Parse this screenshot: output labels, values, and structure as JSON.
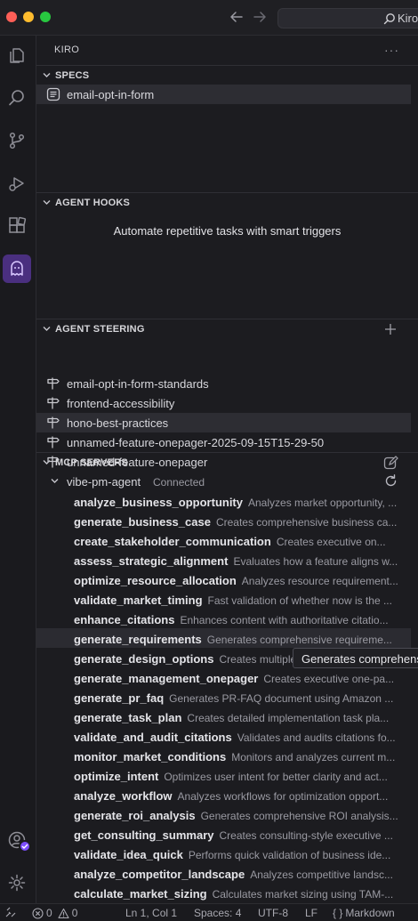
{
  "window": {
    "search_text": "Kiro"
  },
  "sidebar": {
    "title": "KIRO",
    "more": "···"
  },
  "specs": {
    "title": "SPECS",
    "items": [
      {
        "label": "email-opt-in-form"
      }
    ]
  },
  "hooks": {
    "title": "AGENT HOOKS",
    "empty_message": "Automate repetitive tasks with smart triggers"
  },
  "steering": {
    "title": "AGENT STEERING",
    "items": [
      {
        "label": "email-opt-in-form-standards"
      },
      {
        "label": "frontend-accessibility"
      },
      {
        "label": "hono-best-practices"
      },
      {
        "label": "unnamed-feature-onepager-2025-09-15T15-29-50"
      },
      {
        "label": "unnamed-feature-onepager"
      }
    ]
  },
  "mcp": {
    "title": "MCP SERVERS",
    "server": {
      "name": "vibe-pm-agent",
      "status": "Connected"
    },
    "tools": [
      {
        "name": "analyze_business_opportunity",
        "desc": "Analyzes market opportunity, ..."
      },
      {
        "name": "generate_business_case",
        "desc": "Creates comprehensive business ca..."
      },
      {
        "name": "create_stakeholder_communication",
        "desc": "Creates executive on..."
      },
      {
        "name": "assess_strategic_alignment",
        "desc": "Evaluates how a feature aligns w..."
      },
      {
        "name": "optimize_resource_allocation",
        "desc": "Analyzes resource requirement..."
      },
      {
        "name": "validate_market_timing",
        "desc": "Fast validation of whether now is the ..."
      },
      {
        "name": "enhance_citations",
        "desc": "Enhances content with authoritative citatio..."
      },
      {
        "name": "generate_requirements",
        "desc": "Generates comprehensive requireme..."
      },
      {
        "name": "generate_design_options",
        "desc": "Creates multiple"
      },
      {
        "name": "generate_management_onepager",
        "desc": "Creates executive one-pa..."
      },
      {
        "name": "generate_pr_faq",
        "desc": "Generates PR-FAQ document using Amazon ..."
      },
      {
        "name": "generate_task_plan",
        "desc": "Creates detailed implementation task pla..."
      },
      {
        "name": "validate_and_audit_citations",
        "desc": "Validates and audits citations fo..."
      },
      {
        "name": "monitor_market_conditions",
        "desc": "Monitors and analyzes current m..."
      },
      {
        "name": "optimize_intent",
        "desc": "Optimizes user intent for better clarity and act..."
      },
      {
        "name": "analyze_workflow",
        "desc": "Analyzes workflows for optimization opport..."
      },
      {
        "name": "generate_roi_analysis",
        "desc": "Generates comprehensive ROI analysis..."
      },
      {
        "name": "get_consulting_summary",
        "desc": "Creates consulting-style executive ..."
      },
      {
        "name": "validate_idea_quick",
        "desc": "Performs quick validation of business ide..."
      },
      {
        "name": "analyze_competitor_landscape",
        "desc": "Analyzes competitive landsc..."
      },
      {
        "name": "calculate_market_sizing",
        "desc": "Calculates market sizing using TAM-..."
      }
    ],
    "tooltip": "Generates comprehens"
  },
  "status": {
    "errors": "0",
    "warnings": "0",
    "position": "Ln 1, Col 1",
    "spaces": "Spaces: 4",
    "encoding": "UTF-8",
    "eol": "LF",
    "language": "Markdown",
    "language_prefix": "{ }"
  }
}
